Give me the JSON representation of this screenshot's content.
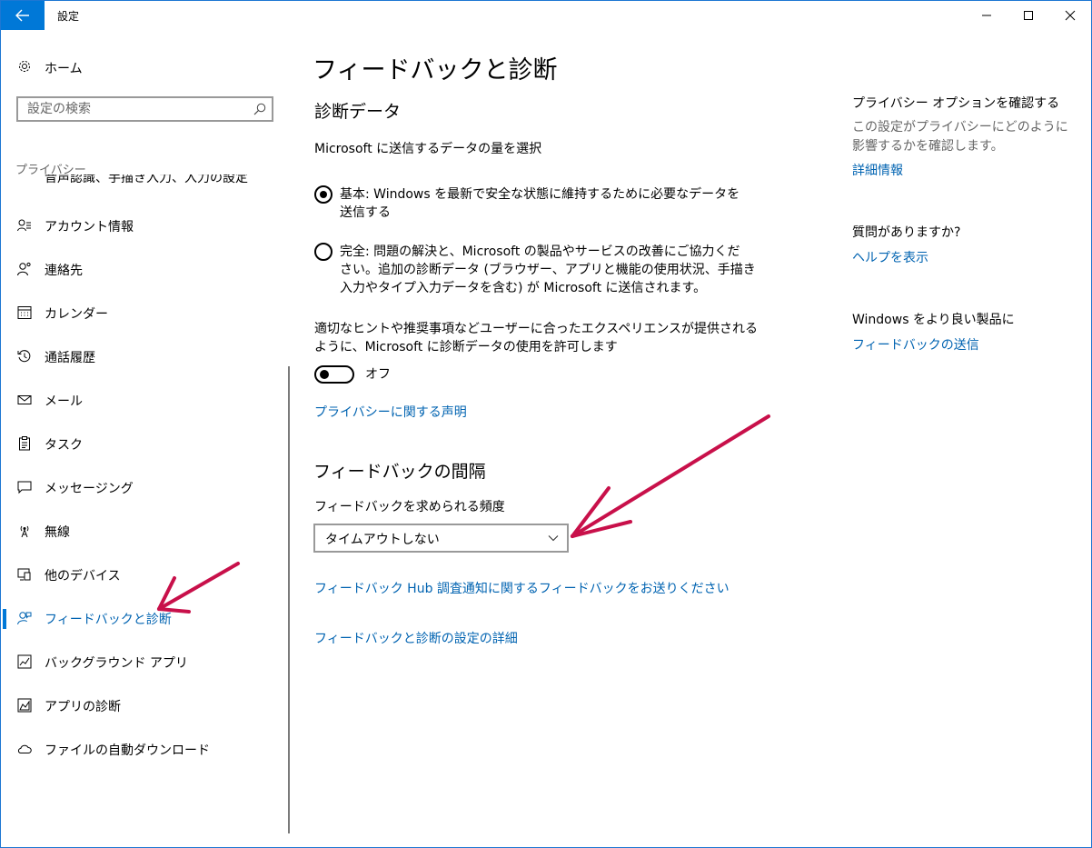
{
  "window": {
    "title": "設定"
  },
  "sidebar": {
    "home_label": "ホーム",
    "search_placeholder": "設定の検索",
    "section_label": "プライバシー",
    "cut_item_label": "音声認識、手描き入力、入力の設定",
    "items": [
      {
        "label": "アカウント情報",
        "icon": "account-info-icon"
      },
      {
        "label": "連絡先",
        "icon": "contacts-icon"
      },
      {
        "label": "カレンダー",
        "icon": "calendar-icon"
      },
      {
        "label": "通話履歴",
        "icon": "call-history-icon"
      },
      {
        "label": "メール",
        "icon": "mail-icon"
      },
      {
        "label": "タスク",
        "icon": "tasks-icon"
      },
      {
        "label": "メッセージング",
        "icon": "messaging-icon"
      },
      {
        "label": "無線",
        "icon": "radio-icon"
      },
      {
        "label": "他のデバイス",
        "icon": "other-devices-icon"
      },
      {
        "label": "フィードバックと診断",
        "icon": "feedback-icon",
        "selected": true
      },
      {
        "label": "バックグラウンド アプリ",
        "icon": "background-apps-icon"
      },
      {
        "label": "アプリの診断",
        "icon": "app-diagnostics-icon"
      },
      {
        "label": "ファイルの自動ダウンロード",
        "icon": "cloud-icon"
      }
    ]
  },
  "main": {
    "title": "フィードバックと診断",
    "diag_heading": "診断データ",
    "diag_subtitle": "Microsoft に送信するデータの量を選択",
    "radio_basic_line1": "基本: Windows を最新で安全な状態に維持するために必要なデータを",
    "radio_basic_line2": "送信する",
    "radio_full_line1": "完全: 問題の解決と、Microsoft の製品やサービスの改善にご協力くだ",
    "radio_full_line2": "さい。追加の診断データ (ブラウザー、アプリと機能の使用状況、手描き",
    "radio_full_line3": "入力やタイプ入力データを含む) が Microsoft に送信されます。",
    "radio_selected": "basic",
    "tailored_line1": "適切なヒントや推奨事項などユーザーに合ったエクスペリエンスが提供される",
    "tailored_line2": "ように、Microsoft に診断データの使用を許可します",
    "toggle_state": "オフ",
    "privacy_link": "プライバシーに関する声明",
    "feedback_heading": "フィードバックの間隔",
    "frequency_label": "フィードバックを求められる頻度",
    "frequency_value": "タイムアウトしない",
    "hub_link": "フィードバック Hub 調査通知に関するフィードバックをお送りください",
    "details_link": "フィードバックと診断の設定の詳細"
  },
  "right": {
    "privacy_heading": "プライバシー オプションを確認する",
    "privacy_text": "この設定がプライバシーにどのように影響するかを確認します。",
    "privacy_link": "詳細情報",
    "question_heading": "質問がありますか?",
    "help_link": "ヘルプを表示",
    "improve_heading": "Windows をより良い製品に",
    "feedback_link": "フィードバックの送信"
  },
  "colors": {
    "accent": "#0078d7",
    "link": "#0063b1",
    "annotation_arrow": "#c8104a"
  }
}
